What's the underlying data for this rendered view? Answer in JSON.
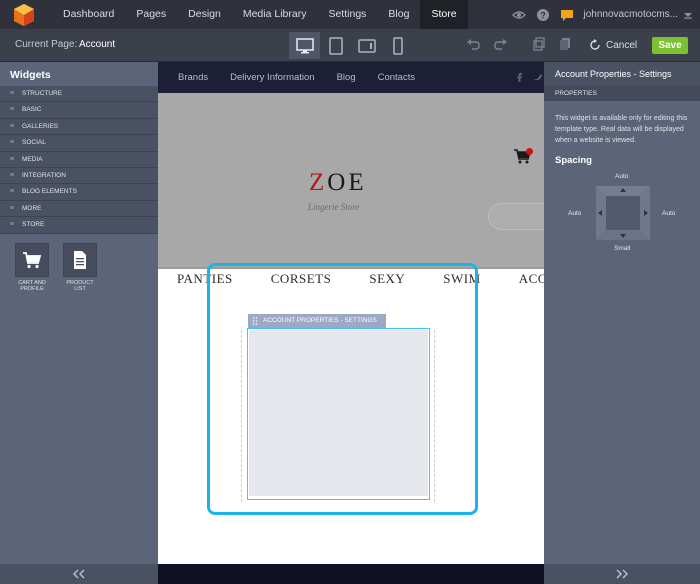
{
  "topbar": {
    "nav": [
      "Dashboard",
      "Pages",
      "Design",
      "Media Library",
      "Settings",
      "Blog",
      "Store"
    ],
    "active_nav": "Store",
    "user": "johnnovacmotocms...",
    "icons": [
      "view-icon",
      "help-icon",
      "chat-icon"
    ]
  },
  "toolbar": {
    "current_page_label": "Current Page:",
    "current_page": "Account",
    "devices": [
      "desktop-icon",
      "tablet-icon",
      "tablet-landscape-icon",
      "phone-icon"
    ],
    "cancel_label": "Cancel",
    "save_label": "Save",
    "save_color": "#7ac232"
  },
  "left_panel": {
    "title": "Widgets",
    "categories": [
      "STRUCTURE",
      "BASIC",
      "GALLERIES",
      "SOCIAL",
      "MEDIA",
      "INTEGRATION",
      "BLOG ELEMENTS",
      "MORE",
      "STORE"
    ],
    "widgets": [
      {
        "label_line1": "CART AND",
        "label_line2": "PROFILE",
        "icon": "cart-icon"
      },
      {
        "label_line1": "PRODUCT",
        "label_line2": "LIST",
        "icon": "document-icon"
      }
    ]
  },
  "canvas": {
    "site_nav": [
      "Brands",
      "Delivery Information",
      "Blog",
      "Contacts"
    ],
    "brand_first": "Z",
    "brand_rest": "OE",
    "tagline": "Lingerie Store",
    "cart_badge": "0",
    "categories": [
      "PANTIES",
      "CORSETS",
      "SEXY",
      "SWIM",
      "ACCESSO"
    ],
    "widget_tag": "ACCOUNT PROPERTIES - SETTINGS",
    "selection_color": "#1cb3e8"
  },
  "right_panel": {
    "title": "Account Properties - Settings",
    "section": "PROPERTIES",
    "note": "This widget is available only for editing this template type. Real data will be displayed when a website is viewed.",
    "spacing_title": "Spacing",
    "spacing": {
      "top": "Auto",
      "left": "Auto",
      "right": "Auto",
      "bottom": "Small"
    }
  }
}
